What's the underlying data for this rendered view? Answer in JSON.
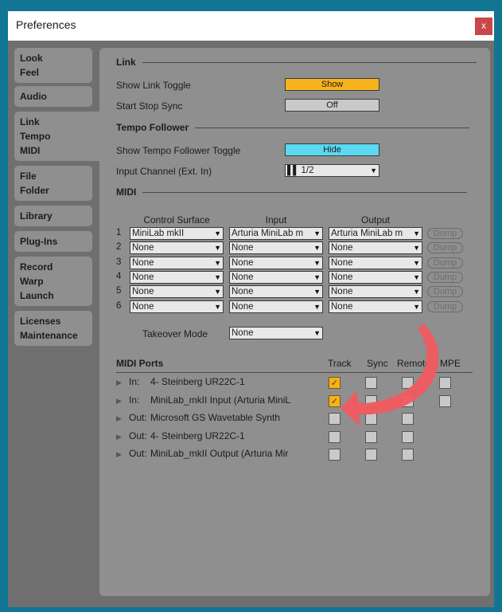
{
  "window": {
    "title": "Preferences",
    "close_label": "x"
  },
  "sidebar": {
    "tabs": [
      {
        "id": "look-feel",
        "lines": [
          "Look",
          "Feel"
        ],
        "active": false
      },
      {
        "id": "audio",
        "lines": [
          "Audio"
        ],
        "active": false
      },
      {
        "id": "link-tempo-midi",
        "lines": [
          "Link",
          "Tempo",
          "MIDI"
        ],
        "active": true
      },
      {
        "id": "file-folder",
        "lines": [
          "File",
          "Folder"
        ],
        "active": false
      },
      {
        "id": "library",
        "lines": [
          "Library"
        ],
        "active": false
      },
      {
        "id": "plug-ins",
        "lines": [
          "Plug-Ins"
        ],
        "active": false
      },
      {
        "id": "record-warp-launch",
        "lines": [
          "Record",
          "Warp",
          "Launch"
        ],
        "active": false
      },
      {
        "id": "licenses-maintenance",
        "lines": [
          "Licenses",
          "Maintenance"
        ],
        "active": false
      }
    ]
  },
  "link": {
    "heading": "Link",
    "show_link_toggle": {
      "label": "Show Link Toggle",
      "value": "Show",
      "color": "#f7b31c"
    },
    "start_stop_sync": {
      "label": "Start Stop Sync",
      "value": "Off",
      "color": "#c9c9c9"
    }
  },
  "tempo_follower": {
    "heading": "Tempo Follower",
    "show_toggle": {
      "label": "Show Tempo Follower Toggle",
      "value": "Hide",
      "color": "#5ad9f0"
    },
    "input_channel": {
      "label": "Input Channel (Ext. In)",
      "value": "1/2"
    }
  },
  "midi": {
    "heading": "MIDI",
    "columns": {
      "control_surface": "Control Surface",
      "input": "Input",
      "output": "Output"
    },
    "dump_label": "Dump",
    "rows": [
      {
        "num": "1",
        "surface": "MiniLab mkII",
        "input": "Arturia MiniLab m",
        "output": "Arturia MiniLab m"
      },
      {
        "num": "2",
        "surface": "None",
        "input": "None",
        "output": "None"
      },
      {
        "num": "3",
        "surface": "None",
        "input": "None",
        "output": "None"
      },
      {
        "num": "4",
        "surface": "None",
        "input": "None",
        "output": "None"
      },
      {
        "num": "5",
        "surface": "None",
        "input": "None",
        "output": "None"
      },
      {
        "num": "6",
        "surface": "None",
        "input": "None",
        "output": "None"
      }
    ],
    "takeover_mode": {
      "label": "Takeover Mode",
      "value": "None"
    }
  },
  "midi_ports": {
    "heading": "MIDI Ports",
    "columns": {
      "track": "Track",
      "sync": "Sync",
      "remote": "Remote",
      "mpe": "MPE"
    },
    "ports": [
      {
        "dir": "In:",
        "name": "4- Steinberg UR22C-1",
        "track": true,
        "sync": false,
        "remote": false,
        "mpe": false,
        "has_mpe": true
      },
      {
        "dir": "In:",
        "name": "MiniLab_mkII Input (Arturia MiniL",
        "track": true,
        "sync": false,
        "remote": false,
        "mpe": false,
        "has_mpe": true
      },
      {
        "dir": "Out:",
        "name": "Microsoft GS Wavetable Synth",
        "track": false,
        "sync": false,
        "remote": false,
        "has_mpe": false
      },
      {
        "dir": "Out:",
        "name": "4- Steinberg UR22C-1",
        "track": false,
        "sync": false,
        "remote": false,
        "has_mpe": false
      },
      {
        "dir": "Out:",
        "name": "MiniLab_mkII Output (Arturia Mir",
        "track": false,
        "sync": false,
        "remote": false,
        "has_mpe": false
      }
    ]
  },
  "annotation": {
    "arrow_color": "#f25a5f",
    "points_to": "track-column"
  },
  "icons": {
    "dropdown": "triangle-down",
    "expand": "triangle-right",
    "check": "checkmark",
    "channel": "stereo-bars"
  }
}
